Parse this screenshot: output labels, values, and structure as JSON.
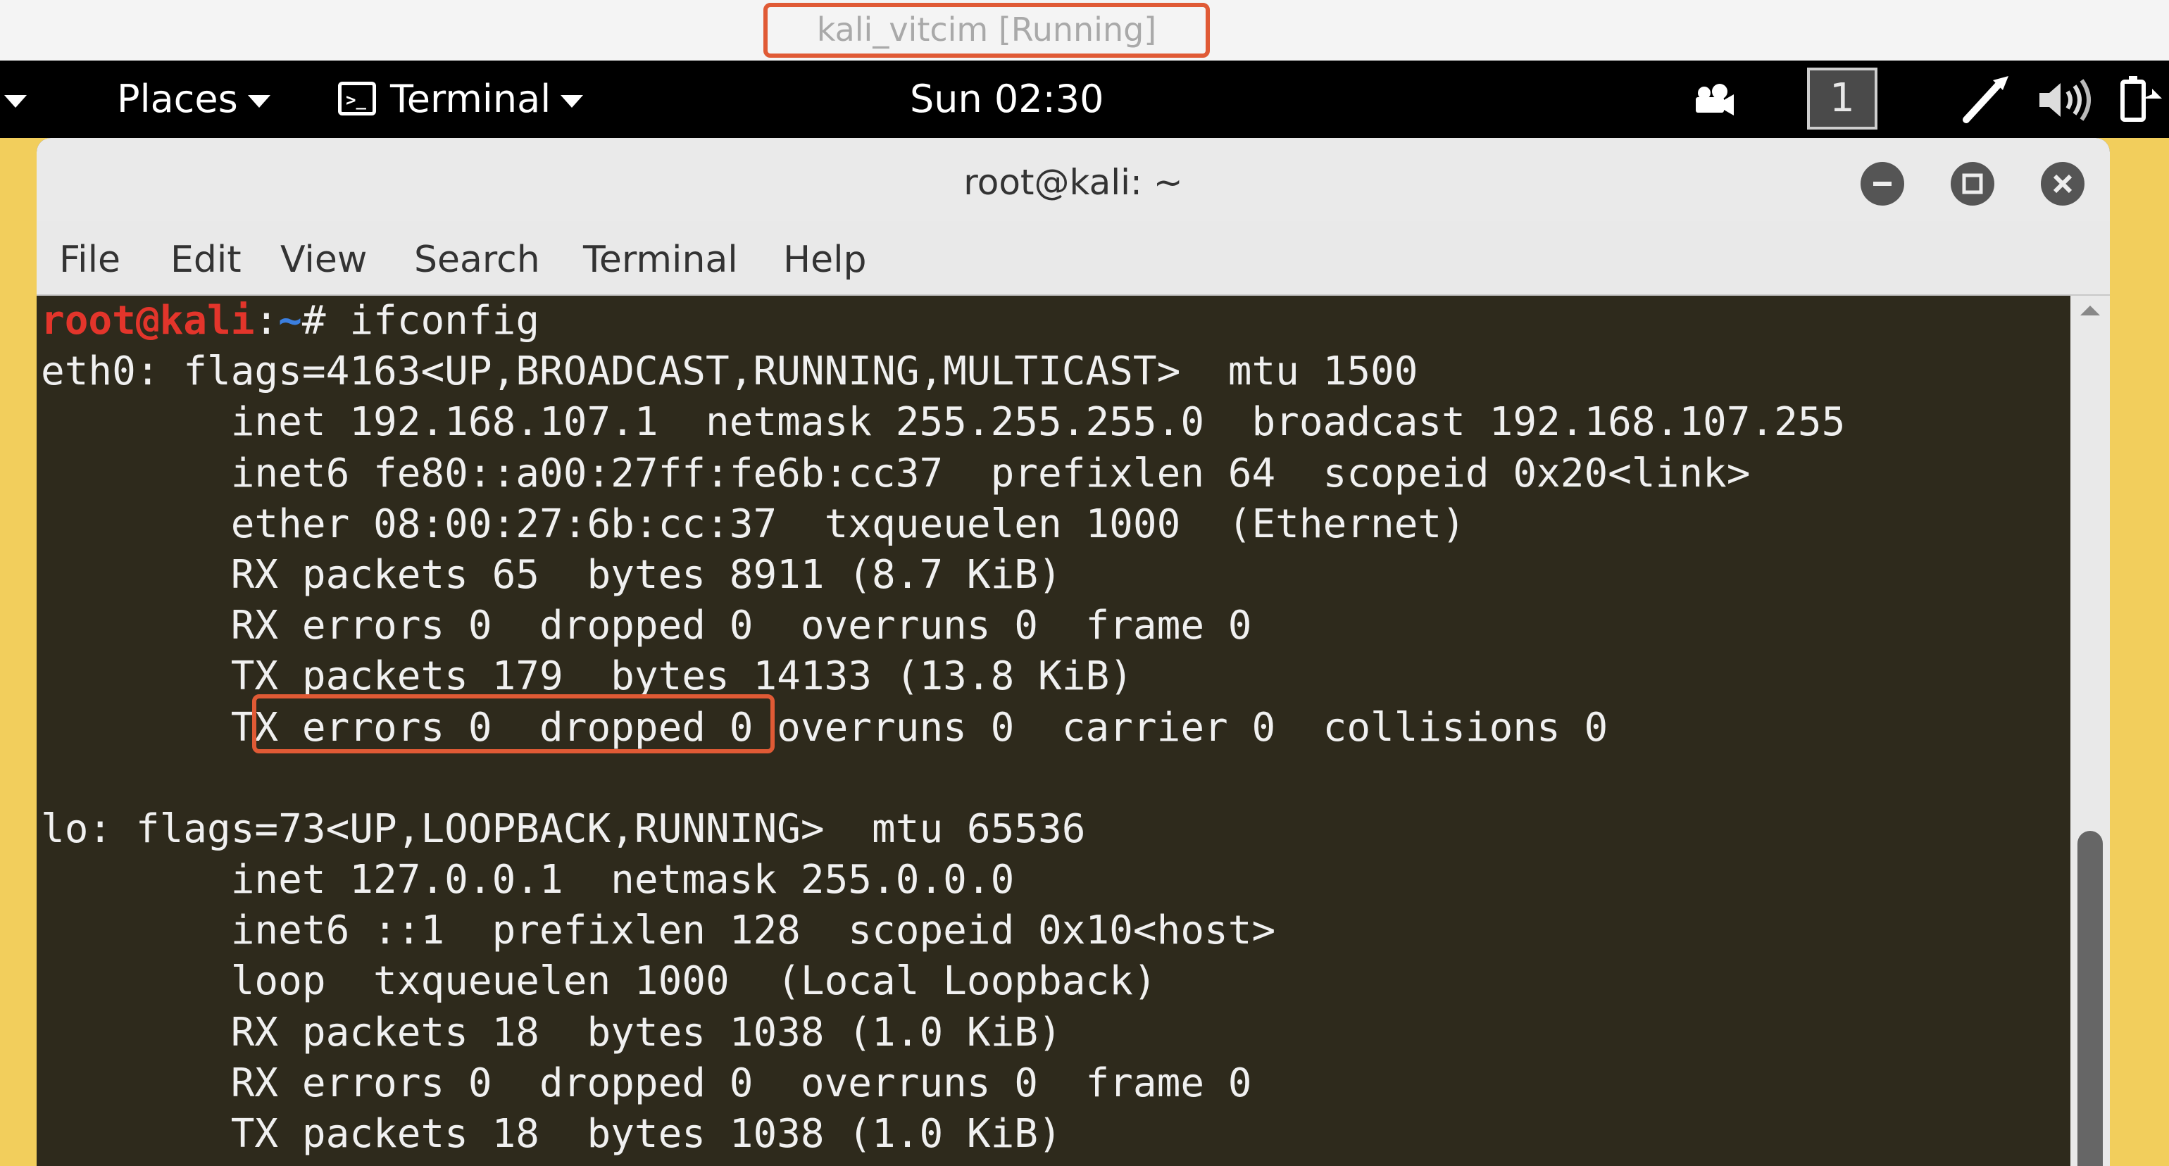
{
  "vm": {
    "title": "kali_vitcim [Running]"
  },
  "panel": {
    "places_label": "Places",
    "app_label": "Terminal",
    "clock": "Sun 02:30",
    "workspace_number": "1",
    "icons": [
      "activities-arrow-icon",
      "video-camera-icon",
      "pen-icon",
      "volume-icon",
      "battery-icon"
    ]
  },
  "window": {
    "title": "root@kali: ~",
    "menu": [
      "File",
      "Edit",
      "View",
      "Search",
      "Terminal",
      "Help"
    ]
  },
  "terminal": {
    "prompt_user": "root@kali",
    "prompt_sep": ":",
    "prompt_path": "~",
    "prompt_end": "# ",
    "command": "ifconfig",
    "output": [
      "eth0: flags=4163<UP,BROADCAST,RUNNING,MULTICAST>  mtu 1500",
      "        inet 192.168.107.1  netmask 255.255.255.0  broadcast 192.168.107.255",
      "        inet6 fe80::a00:27ff:fe6b:cc37  prefixlen 64  scopeid 0x20<link>",
      "        ether 08:00:27:6b:cc:37  txqueuelen 1000  (Ethernet)",
      "        RX packets 65  bytes 8911 (8.7 KiB)",
      "        RX errors 0  dropped 0  overruns 0  frame 0",
      "        TX packets 179  bytes 14133 (13.8 KiB)",
      "        TX errors 0  dropped 0 overruns 0  carrier 0  collisions 0",
      "",
      "lo: flags=73<UP,LOOPBACK,RUNNING>  mtu 65536",
      "        inet 127.0.0.1  netmask 255.0.0.0",
      "        inet6 ::1  prefixlen 128  scopeid 0x10<host>",
      "        loop  txqueuelen 1000  (Local Loopback)",
      "        RX packets 18  bytes 1038 (1.0 KiB)",
      "        RX errors 0  dropped 0  overruns 0  frame 0",
      "        TX packets 18  bytes 1038 (1.0 KiB)"
    ]
  },
  "colors": {
    "highlight": "#e05a35",
    "prompt_user": "#e3352b",
    "prompt_path": "#3b7fe0",
    "terminal_bg": "#2e2a1c",
    "desktop": "#f2ce5c"
  }
}
